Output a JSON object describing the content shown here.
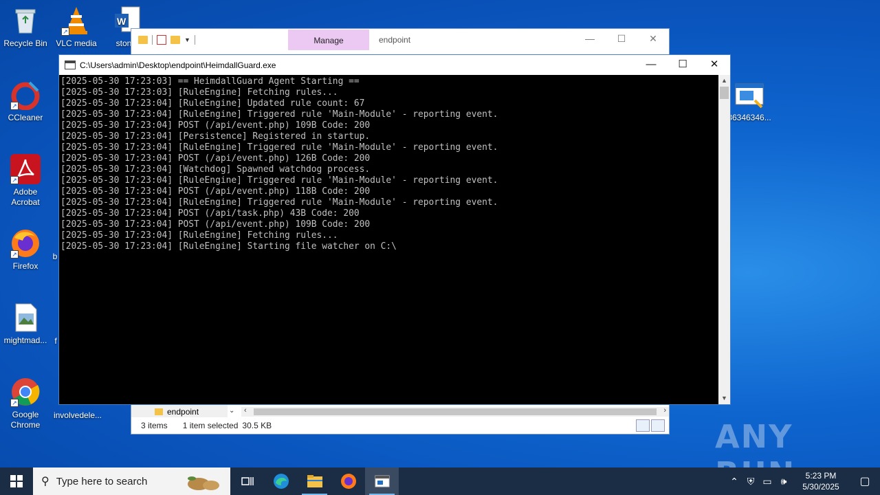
{
  "desktop": {
    "icons": [
      {
        "label": "Recycle Bin"
      },
      {
        "label": "VLC media"
      },
      {
        "label": "stonef"
      },
      {
        "label": "CCleaner"
      },
      {
        "label": "Adobe Acrobat"
      },
      {
        "label": "Firefox"
      },
      {
        "label": "b"
      },
      {
        "label": "mightmad..."
      },
      {
        "label": "f"
      },
      {
        "label": "Google Chrome"
      },
      {
        "label": "involvedele..."
      },
      {
        "label": "36346346..."
      }
    ]
  },
  "explorer": {
    "manage_tab": "Manage",
    "title": "endpoint",
    "nav_folder": "endpoint",
    "status_items": "3 items",
    "status_selected": "1 item selected",
    "status_size": "30.5 KB"
  },
  "console": {
    "title": "C:\\Users\\admin\\Desktop\\endpoint\\HeimdallGuard.exe",
    "lines": [
      "[2025-05-30 17:23:03] == HeimdallGuard Agent Starting ==",
      "[2025-05-30 17:23:03] [RuleEngine] Fetching rules...",
      "[2025-05-30 17:23:04] [RuleEngine] Updated rule count: 67",
      "[2025-05-30 17:23:04] [RuleEngine] Triggered rule 'Main-Module' - reporting event.",
      "[2025-05-30 17:23:04] POST (/api/event.php) 109B Code: 200",
      "[2025-05-30 17:23:04] [Persistence] Registered in startup.",
      "[2025-05-30 17:23:04] [RuleEngine] Triggered rule 'Main-Module' - reporting event.",
      "[2025-05-30 17:23:04] POST (/api/event.php) 126B Code: 200",
      "[2025-05-30 17:23:04] [Watchdog] Spawned watchdog process.",
      "[2025-05-30 17:23:04] [RuleEngine] Triggered rule 'Main-Module' - reporting event.",
      "[2025-05-30 17:23:04] POST (/api/event.php) 118B Code: 200",
      "[2025-05-30 17:23:04] [RuleEngine] Triggered rule 'Main-Module' - reporting event.",
      "[2025-05-30 17:23:04] POST (/api/task.php) 43B Code: 200",
      "[2025-05-30 17:23:04] POST (/api/event.php) 109B Code: 200",
      "[2025-05-30 17:23:04] [RuleEngine] Fetching rules...",
      "[2025-05-30 17:23:04] [RuleEngine] Starting file watcher on C:\\"
    ]
  },
  "taskbar": {
    "search_placeholder": "Type here to search",
    "time": "5:23 PM",
    "date": "5/30/2025"
  },
  "watermark": "ANY RUN"
}
